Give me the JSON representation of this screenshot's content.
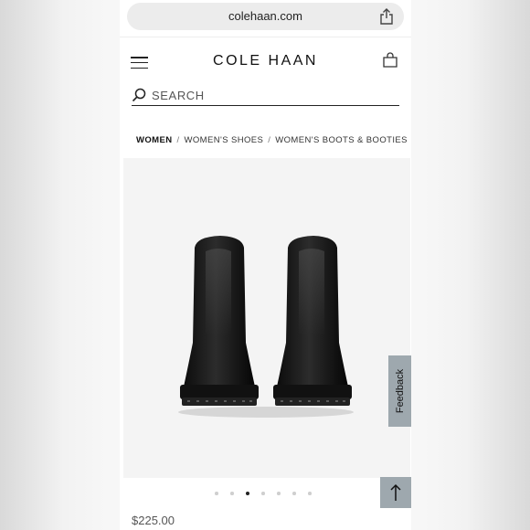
{
  "browser": {
    "url": "colehaan.com"
  },
  "header": {
    "brand": "COLE HAAN"
  },
  "search": {
    "placeholder": "SEARCH"
  },
  "breadcrumb": [
    "WOMEN",
    "WOMEN'S SHOES",
    "WOMEN'S BOOTS & BOOTIES"
  ],
  "feedback": {
    "label": "Feedback"
  },
  "carousel": {
    "count": 7,
    "active_index": 2
  },
  "product": {
    "price": "$225.00"
  },
  "colors": {
    "accent_tab": "#9ea8ae",
    "text": "#111111",
    "image_bg": "#f4f4f4"
  }
}
